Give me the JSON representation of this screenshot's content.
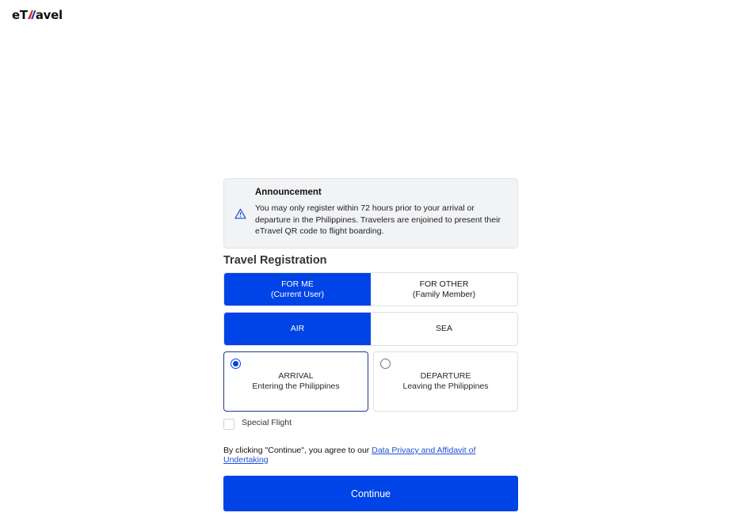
{
  "header": {
    "logo_prefix": "eT",
    "logo_suffix": "avel"
  },
  "announcement": {
    "title": "Announcement",
    "body": "You may only register within 72 hours prior to your arrival or departure in the Philippines. Travelers are enjoined to present their eTravel QR code to flight boarding.",
    "icon": "warning-triangle-icon"
  },
  "registration": {
    "title": "Travel Registration",
    "who": {
      "me_line1": "FOR ME",
      "me_line2": "(Current User)",
      "other_line1": "FOR OTHER",
      "other_line2": "(Family Member)",
      "selected": "me"
    },
    "mode": {
      "air": "AIR",
      "sea": "SEA",
      "selected": "air"
    },
    "direction": {
      "arrival_title": "ARRIVAL",
      "arrival_sub": "Entering the Philippines",
      "departure_title": "DEPARTURE",
      "departure_sub": "Leaving the Philippines",
      "selected": "arrival"
    },
    "special_flight_label": "Special Flight",
    "consent_text": "By clicking \"Continue\", you agree to our ",
    "consent_link": "Data Privacy and Affidavit of Undertaking",
    "continue_label": "Continue"
  },
  "colors": {
    "primary": "#0043e6",
    "announcement_bg": "#f2f3f5",
    "link": "#1f4fd6"
  }
}
